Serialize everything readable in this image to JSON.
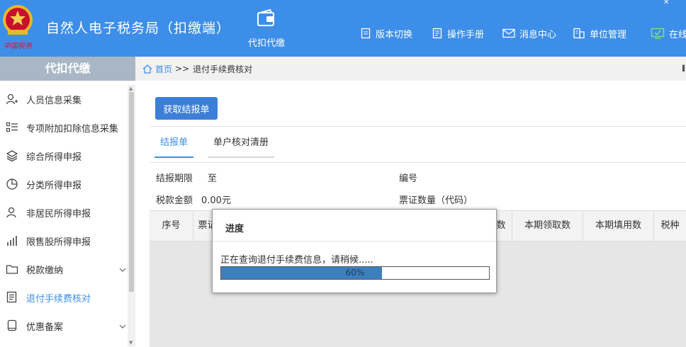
{
  "header": {
    "title": "自然人电子税务局（扣缴端）",
    "emblem_text": "中国税务",
    "nav_center": "代扣代缴",
    "nav": [
      {
        "label": "版本切换",
        "icon": "document-icon"
      },
      {
        "label": "操作手册",
        "icon": "manual-icon"
      },
      {
        "label": "消息中心",
        "icon": "mail-icon"
      },
      {
        "label": "单位管理",
        "icon": "building-icon"
      },
      {
        "label": "在线",
        "icon": "monitor-icon"
      }
    ],
    "accent_color": "#3d8ee8"
  },
  "sidebar": {
    "title": "代扣代缴",
    "items": [
      {
        "label": "人员信息采集",
        "icon": "person-add-icon"
      },
      {
        "label": "专项附加扣除信息采集",
        "icon": "list-icon"
      },
      {
        "label": "综合所得申报",
        "icon": "layers-icon"
      },
      {
        "label": "分类所得申报",
        "icon": "pie-icon"
      },
      {
        "label": "非居民所得申报",
        "icon": "person-icon"
      },
      {
        "label": "限售股所得申报",
        "icon": "bar-chart-icon"
      },
      {
        "label": "税款缴纳",
        "icon": "folder-icon"
      },
      {
        "label": "退付手续费核对",
        "icon": "form-icon",
        "active": true
      },
      {
        "label": "优惠备案",
        "icon": "file-icon"
      }
    ]
  },
  "breadcrumb": {
    "home": "首页",
    "separator": ">>",
    "current": "退付手续费核对"
  },
  "main": {
    "fetch_button": "获取结报单",
    "tabs": [
      "结报单",
      "单户核对清册"
    ],
    "fields": {
      "period_label": "结报期限",
      "period_value": "至",
      "number_label": "编号",
      "amount_label": "税款金额",
      "amount_value": "0.00元",
      "voucher_label": "票证数量（代码）"
    },
    "table_headers": [
      "序号",
      "票证",
      "数",
      "本期领取数",
      "本期填用数",
      "税种"
    ]
  },
  "modal": {
    "title": "进度",
    "message": "正在查询退付手续费信息，请稍候.....",
    "progress": 60,
    "progress_text": "60%"
  }
}
